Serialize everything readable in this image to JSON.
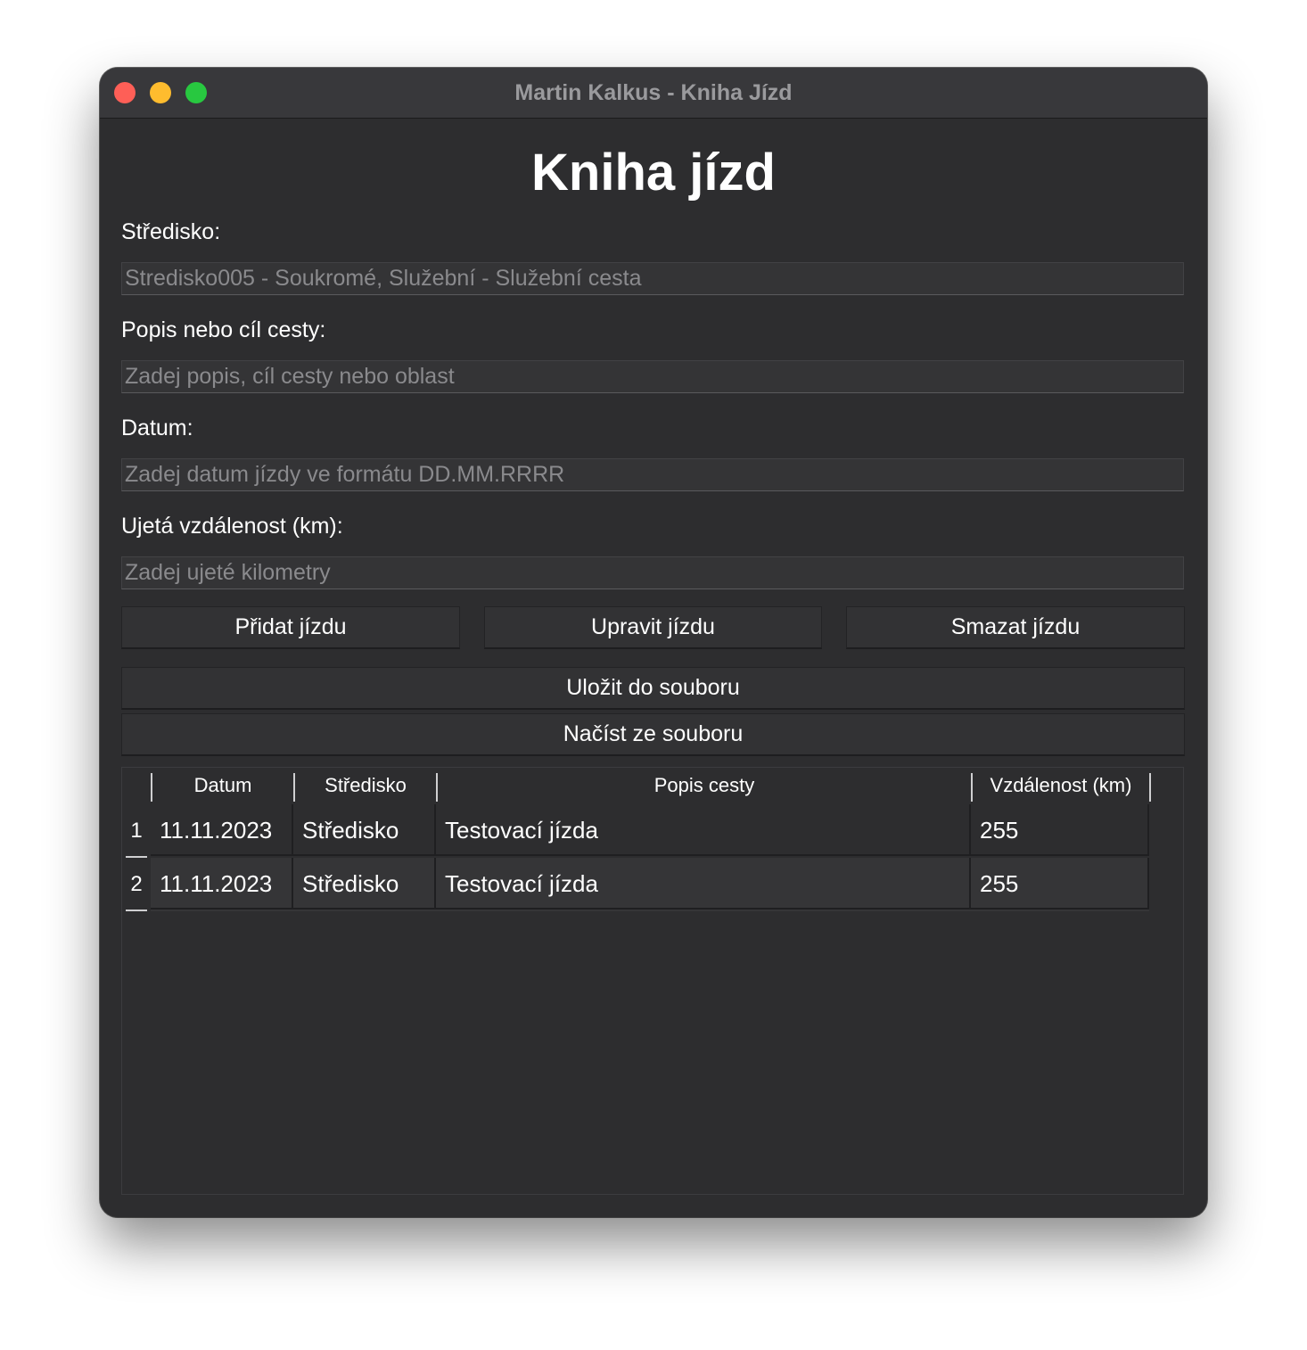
{
  "window": {
    "title": "Martin Kalkus - Kniha Jízd"
  },
  "page": {
    "heading": "Kniha jízd"
  },
  "form": {
    "stredisko": {
      "label": "Středisko:",
      "value": "",
      "placeholder": "Stredisko005 - Soukromé, Služební - Služební cesta"
    },
    "popis": {
      "label": "Popis nebo cíl cesty:",
      "value": "",
      "placeholder": "Zadej popis, cíl cesty nebo oblast"
    },
    "datum": {
      "label": "Datum:",
      "value": "",
      "placeholder": "Zadej datum jízdy ve formátu DD.MM.RRRR"
    },
    "vzdalenost": {
      "label": "Ujetá vzdálenost (km):",
      "value": "",
      "placeholder": "Zadej ujeté kilometry"
    }
  },
  "buttons": {
    "add": "Přidat jízdu",
    "edit": "Upravit jízdu",
    "delete": "Smazat jízdu",
    "save": "Uložit do souboru",
    "load": "Načíst ze souboru"
  },
  "table": {
    "columns": [
      "Datum",
      "Středisko",
      "Popis cesty",
      "Vzdálenost (km)"
    ],
    "rows": [
      {
        "index": "1",
        "datum": "11.11.2023",
        "stredisko": "Středisko",
        "popis": "Testovací jízda",
        "vzdalenost": "255"
      },
      {
        "index": "2",
        "datum": "11.11.2023",
        "stredisko": "Středisko",
        "popis": "Testovací jízda",
        "vzdalenost": "255"
      }
    ]
  },
  "colors": {
    "window_bg": "#2d2d2f",
    "titlebar_bg": "#38383b",
    "close": "#fe5f57",
    "minimize": "#febc2e",
    "maximize": "#28c840"
  }
}
